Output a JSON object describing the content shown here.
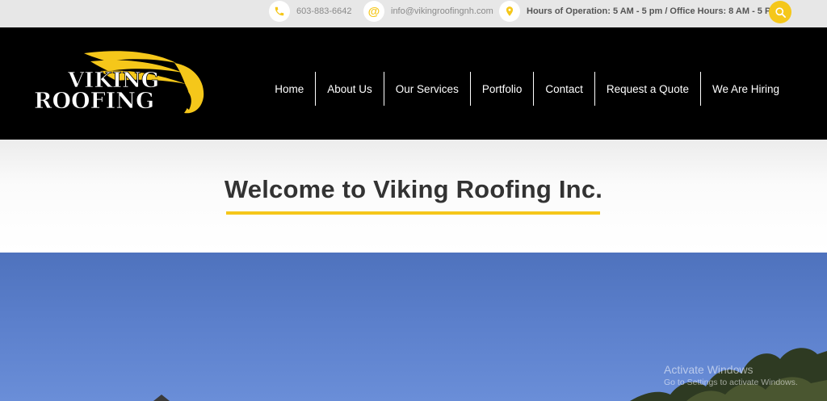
{
  "topbar": {
    "phone": "603-883-6642",
    "email": "info@vikingroofingnh.com",
    "hours": "Hours of Operation: 5 AM - 5 pm / Office Hours: 8 AM - 5 PM",
    "email_icon_glyph": "@"
  },
  "logo": {
    "line1": "VIKING",
    "line2": "ROOFING",
    "accent_color": "#f5c71a"
  },
  "nav": {
    "items": [
      "Home",
      "About Us",
      "Our Services",
      "Portfolio",
      "Contact",
      "Request a Quote",
      "We Are Hiring"
    ]
  },
  "welcome": {
    "title": "Welcome to Viking Roofing Inc."
  },
  "watermark": {
    "line1": "Activate Windows",
    "line2": "Go to Settings to activate Windows."
  },
  "colors": {
    "accent": "#f5c71a",
    "header_bg": "#000000",
    "topbar_bg": "#e7e7e7",
    "sky": "#5b7fcb"
  }
}
